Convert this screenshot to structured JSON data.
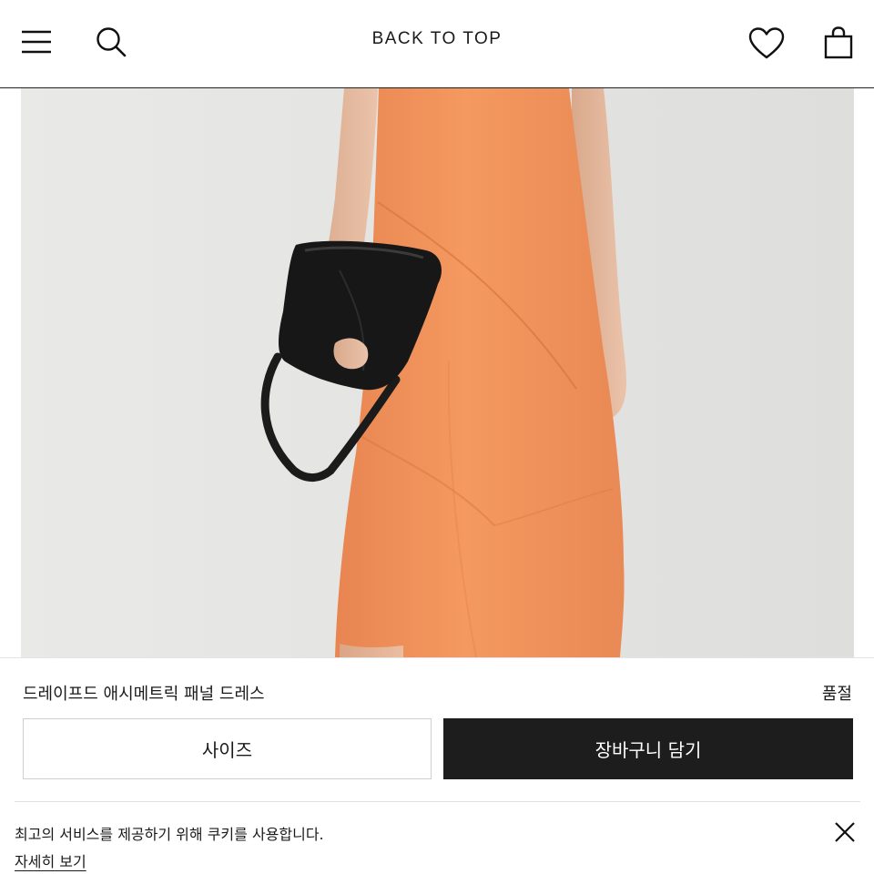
{
  "header": {
    "back_to_top": "BACK TO TOP",
    "icons": {
      "menu": "menu-icon",
      "search": "search-icon",
      "wishlist": "heart-icon",
      "bag": "shopping-bag-icon"
    }
  },
  "product": {
    "name": "드레이프드 애시메트릭 패널 드레스",
    "status": "품절",
    "size_label": "사이즈",
    "add_to_cart_label": "장바구니 담기",
    "dress_color": "#f2935f"
  },
  "cookie": {
    "message": "최고의 서비스를 제공하기 위해 쿠키를 사용합니다.",
    "more_label": "자세히 보기",
    "close_icon": "close-icon"
  },
  "colors": {
    "header_border": "#222222",
    "cart_button_bg": "#1d1d1d",
    "image_background": "#e6e6e4"
  }
}
